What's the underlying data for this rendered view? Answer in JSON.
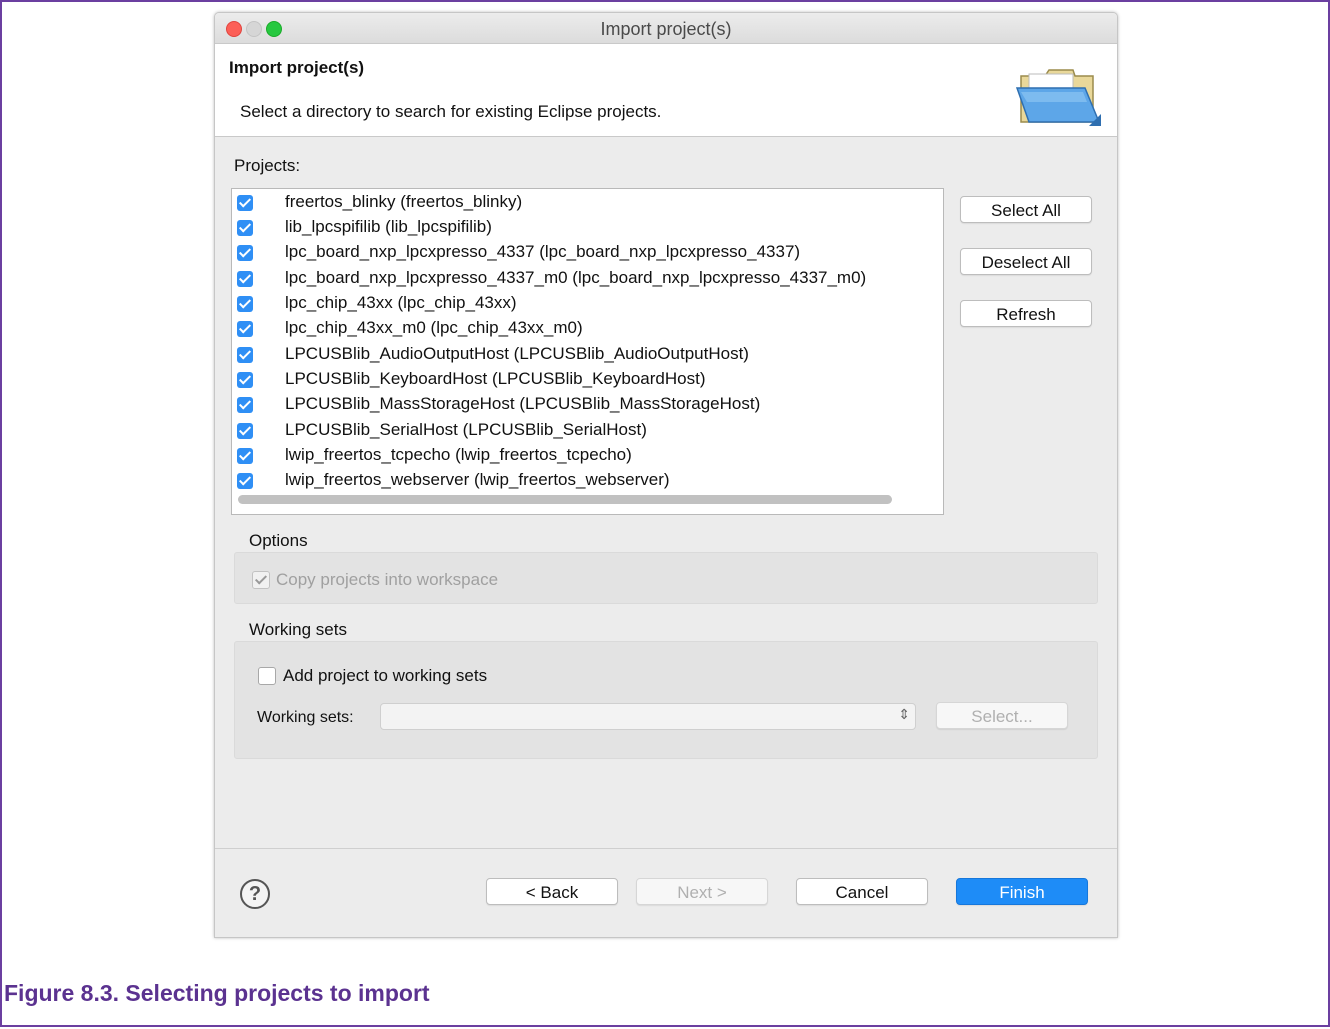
{
  "window": {
    "title": "Import project(s)"
  },
  "banner": {
    "title": "Import project(s)",
    "description": "Select a directory to search for existing Eclipse projects.",
    "icon": "folder-open-icon"
  },
  "projects": {
    "label": "Projects:",
    "items": [
      "freertos_blinky (freertos_blinky)",
      "lib_lpcspifilib (lib_lpcspifilib)",
      "lpc_board_nxp_lpcxpresso_4337 (lpc_board_nxp_lpcxpresso_4337)",
      "lpc_board_nxp_lpcxpresso_4337_m0 (lpc_board_nxp_lpcxpresso_4337_m0)",
      "lpc_chip_43xx (lpc_chip_43xx)",
      "lpc_chip_43xx_m0 (lpc_chip_43xx_m0)",
      "LPCUSBlib_AudioOutputHost (LPCUSBlib_AudioOutputHost)",
      "LPCUSBlib_KeyboardHost (LPCUSBlib_KeyboardHost)",
      "LPCUSBlib_MassStorageHost (LPCUSBlib_MassStorageHost)",
      "LPCUSBlib_SerialHost (LPCUSBlib_SerialHost)",
      "lwip_freertos_tcpecho (lwip_freertos_tcpecho)",
      "lwip_freertos_webserver (lwip_freertos_webserver)"
    ],
    "all_checked": true
  },
  "side_buttons": {
    "select_all": "Select All",
    "deselect_all": "Deselect All",
    "refresh": "Refresh"
  },
  "options": {
    "label": "Options",
    "copy_projects": "Copy projects into workspace",
    "copy_checked": true,
    "copy_disabled": true
  },
  "working_sets": {
    "label": "Working sets",
    "add_to_sets": "Add project to working sets",
    "add_checked": false,
    "field_label": "Working sets:",
    "combo_value": "",
    "select_button": "Select..."
  },
  "footer": {
    "help": "?",
    "back": "< Back",
    "next": "Next >",
    "cancel": "Cancel",
    "finish": "Finish"
  },
  "caption": "Figure 8.3. Selecting projects to import",
  "colors": {
    "accent": "#1e8cf7",
    "frame": "#6b3fa0",
    "caption": "#5b3290"
  }
}
